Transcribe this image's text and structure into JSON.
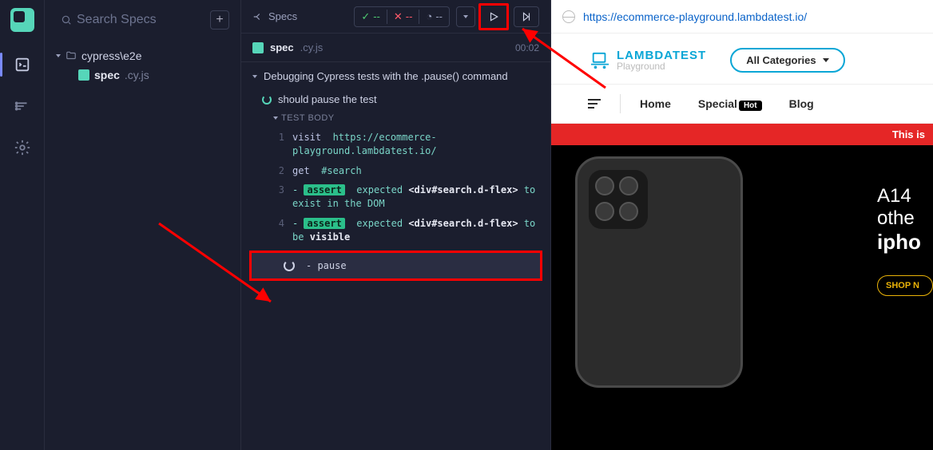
{
  "sidebar": {
    "search_placeholder": "Search Specs",
    "folder": "cypress\\e2e",
    "file_name": "spec",
    "file_ext": ".cy.js"
  },
  "header": {
    "specs_label": "Specs",
    "pass_count": "--",
    "fail_count": "--",
    "pending_count": "--"
  },
  "spec": {
    "name": "spec",
    "ext": ".cy.js",
    "timer": "00:02",
    "suite": "Debugging Cypress tests with the .pause() command",
    "test": "should pause the test",
    "test_body_label": "TEST BODY",
    "commands": [
      {
        "n": "1",
        "name": "visit",
        "arg": "https://ecommerce-playground.lambdatest.io/"
      },
      {
        "n": "2",
        "name": "get",
        "arg": "#search"
      },
      {
        "n": "3",
        "badge": "assert",
        "prefix": "-",
        "text_pre": "expected",
        "target": "<div#search.d-flex>",
        "text_post": "to exist in the DOM"
      },
      {
        "n": "4",
        "badge": "assert",
        "prefix": "-",
        "text_pre": "expected",
        "target": "<div#search.d-flex>",
        "text_post": "to be",
        "strong": "visible"
      }
    ],
    "pause_label": "- pause"
  },
  "preview": {
    "url": "https://ecommerce-playground.lambdatest.io/",
    "brand1": "LAMBDATEST",
    "brand2": "Playground",
    "categories": "All Categories",
    "nav_home": "Home",
    "nav_special": "Special",
    "nav_hot": "Hot",
    "nav_blog": "Blog",
    "strip": "This is",
    "hero_l1": "A14",
    "hero_l2": "othe",
    "hero_l3": "ipho",
    "shop": "SHOP N"
  }
}
